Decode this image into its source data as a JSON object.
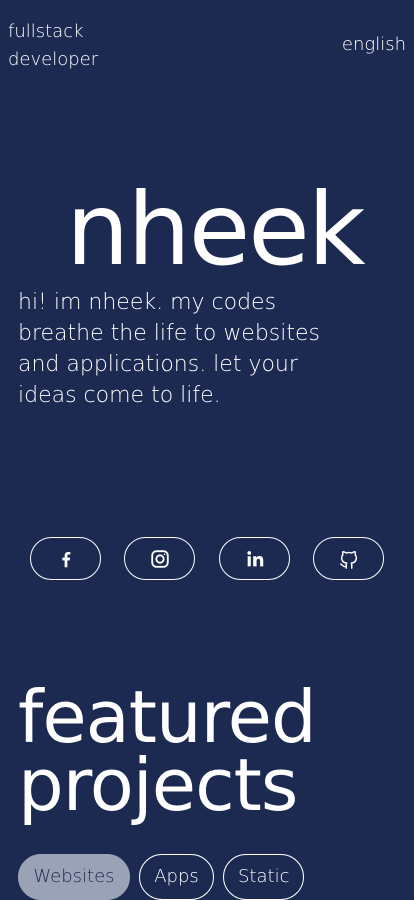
{
  "header": {
    "role_line1": "fullstack",
    "role_line2": "developer",
    "language": "english"
  },
  "hero": {
    "name": "nheek",
    "intro": "hi! im nheek. my codes breathe the life to websites and applications. let your ideas come to life."
  },
  "socials": [
    {
      "icon": "facebook-icon"
    },
    {
      "icon": "instagram-icon"
    },
    {
      "icon": "linkedin-icon"
    },
    {
      "icon": "github-icon"
    }
  ],
  "projects": {
    "heading_line1": "featured",
    "heading_line2": "projects",
    "filters": [
      {
        "label": "Websites",
        "active": true
      },
      {
        "label": "Apps",
        "active": false
      },
      {
        "label": "Static",
        "active": false
      }
    ]
  },
  "colors": {
    "background": "#1c2951",
    "text": "#ffffff",
    "active_filter_bg": "#9aa3b6"
  }
}
